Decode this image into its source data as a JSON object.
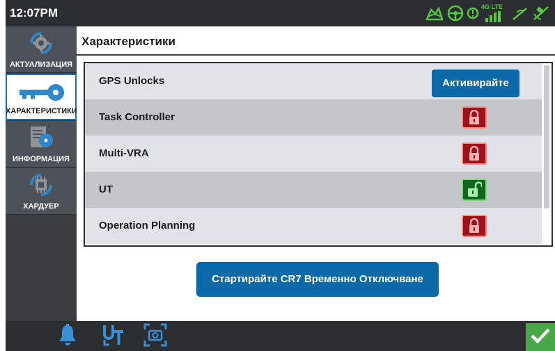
{
  "status_bar": {
    "time": "12:07PM",
    "network_label": "4G LTE",
    "icons": [
      "field-icon",
      "steering-wheel-icon",
      "alert-circle-icon",
      "cell-signal-icon",
      "antenna-icon",
      "satellite-icon"
    ],
    "icon_color": "#59c83c"
  },
  "sidebar": {
    "items": [
      {
        "label": "АКТУАЛИЗАЦИЯ",
        "icon": "update-gear-icon",
        "active": false
      },
      {
        "label": "ХАРАКТЕРИСТИКИ",
        "icon": "key-icon",
        "active": true
      },
      {
        "label": "ИНФОРМАЦИЯ",
        "icon": "info-document-icon",
        "active": false
      },
      {
        "label": "ХАРДУЕР",
        "icon": "hardware-chip-icon",
        "active": false
      }
    ]
  },
  "page": {
    "title": "Характеристики"
  },
  "features": [
    {
      "name": "GPS Unlocks",
      "action": "Активирайте"
    },
    {
      "name": "Task Controller",
      "status": "locked"
    },
    {
      "name": "Multi-VRA",
      "status": "locked"
    },
    {
      "name": "UT",
      "status": "unlocked"
    },
    {
      "name": "Operation Planning",
      "status": "locked"
    }
  ],
  "primary_action": {
    "label": "Стартирайте CR7 Временно Отключване"
  },
  "bottom_bar": {
    "icons": [
      "bell-icon",
      "universal-terminal-icon",
      "screenshot-icon"
    ],
    "confirm_icon": "checkmark-icon"
  },
  "colors": {
    "accent_blue": "#0a6aa8",
    "locked_red": "#a01018",
    "unlocked_green": "#14651e",
    "confirm_green": "#47a848"
  }
}
